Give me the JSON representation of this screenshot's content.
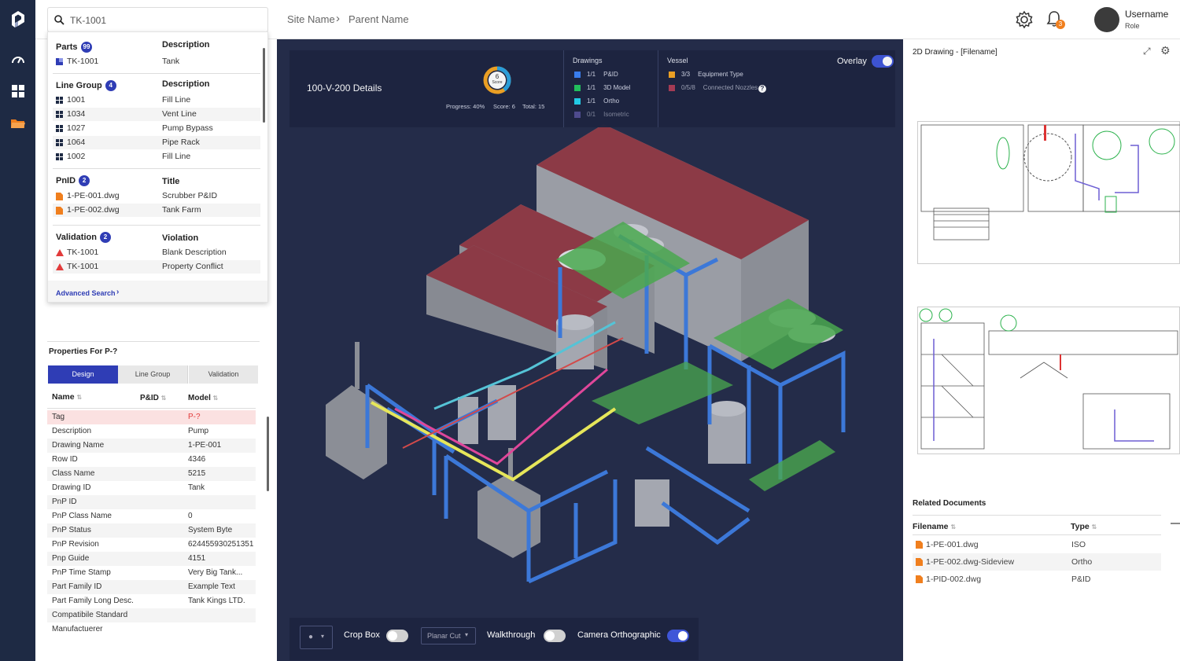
{
  "topbar": {
    "breadcrumb": [
      "Site Name",
      "Parent Name"
    ],
    "notification_count": "3",
    "user": {
      "name": "Username",
      "role": "Role"
    }
  },
  "search": {
    "value": "TK-1001",
    "sections": {
      "parts": {
        "title": "Parts",
        "count": "99",
        "col": "Description",
        "rows": [
          {
            "id": "TK-1001",
            "desc": "Tank"
          }
        ]
      },
      "line_group": {
        "title": "Line Group",
        "count": "4",
        "col": "Description",
        "rows": [
          {
            "id": "1001",
            "desc": "Fill Line"
          },
          {
            "id": "1034",
            "desc": "Vent Line"
          },
          {
            "id": "1027",
            "desc": "Pump Bypass"
          },
          {
            "id": "1064",
            "desc": "Pipe Rack"
          },
          {
            "id": "1002",
            "desc": "Fill Line"
          }
        ]
      },
      "pnid": {
        "title": "PnID",
        "count": "2",
        "col": "Title",
        "rows": [
          {
            "id": "1-PE-001.dwg",
            "desc": "Scrubber P&ID"
          },
          {
            "id": "1-PE-002.dwg",
            "desc": "Tank Farm"
          }
        ]
      },
      "validation": {
        "title": "Validation",
        "count": "2",
        "col": "Violation",
        "rows": [
          {
            "id": "TK-1001",
            "desc": "Blank Description"
          },
          {
            "id": "TK-1001",
            "desc": "Property Conflict"
          }
        ]
      }
    },
    "advanced": "Advanced Search"
  },
  "properties": {
    "title": "Properties For P-?",
    "tabs": [
      "Design",
      "Line Group",
      "Validation"
    ],
    "columns": [
      "Name",
      "P&ID",
      "Model"
    ],
    "rows": [
      {
        "k": "Tag",
        "v": "P-?"
      },
      {
        "k": "Description",
        "v": "Pump"
      },
      {
        "k": "Drawing Name",
        "v": "1-PE-001"
      },
      {
        "k": "Row ID",
        "v": "4346"
      },
      {
        "k": "Class Name",
        "v": "5215"
      },
      {
        "k": "Drawing ID",
        "v": "Tank"
      },
      {
        "k": "PnP ID",
        "v": ""
      },
      {
        "k": "PnP Class Name",
        "v": "0"
      },
      {
        "k": "PnP Status",
        "v": "System Byte"
      },
      {
        "k": "PnP Revision",
        "v": "624455930251351"
      },
      {
        "k": "Pnp Guide",
        "v": "4151"
      },
      {
        "k": "PnP Time Stamp",
        "v": "Very Big Tank..."
      },
      {
        "k": "Part Family ID",
        "v": "Example Text"
      },
      {
        "k": "Part Family Long Desc.",
        "v": "Tank Kings LTD."
      },
      {
        "k": "Compatibile Standard",
        "v": ""
      },
      {
        "k": "Manufactuerer",
        "v": ""
      }
    ]
  },
  "details": {
    "title": "100-V-200 Details",
    "score_value": "6",
    "score_label": "Score",
    "progress": "Progress: 40%",
    "score": "Score: 6",
    "total": "Total: 15",
    "progress_fraction": 0.4,
    "drawings_title": "Drawings",
    "drawings": [
      {
        "count": "1/1",
        "label": "P&ID",
        "color": "#3b82f6"
      },
      {
        "count": "1/1",
        "label": "3D Model",
        "color": "#22c55e"
      },
      {
        "count": "1/1",
        "label": "Ortho",
        "color": "#22d3ee"
      },
      {
        "count": "0/1",
        "label": "Isometric",
        "color": "#7c6fd6"
      }
    ],
    "vessel_title": "Vessel",
    "vessel": [
      {
        "count": "3/3",
        "label": "Equipment Type",
        "color": "#f5a623"
      },
      {
        "count": "0/5/8",
        "label": "Connected Nozzles",
        "color": "#e8475f"
      }
    ],
    "overlay": "Overlay"
  },
  "toolbar": {
    "crop_box": "Crop Box",
    "planar_cut": "Planar Cut",
    "walkthrough": "Walkthrough",
    "camera": "Camera Orthographic"
  },
  "right": {
    "drawing_title": "2D Drawing - [Filename]",
    "related_title": "Related Documents",
    "columns": [
      "Filename",
      "Type"
    ],
    "docs": [
      {
        "file": "1-PE-001.dwg",
        "type": "ISO"
      },
      {
        "file": "1-PE-002.dwg-Sideview",
        "type": "Ortho"
      },
      {
        "file": "1-PID-002.dwg",
        "type": "P&ID"
      }
    ]
  },
  "colors": {
    "rail": "#1e2a44",
    "accent": "#2f3db5",
    "viewer": "#242c49",
    "orange": "#f07f1e",
    "alert": "#e23b3b"
  }
}
